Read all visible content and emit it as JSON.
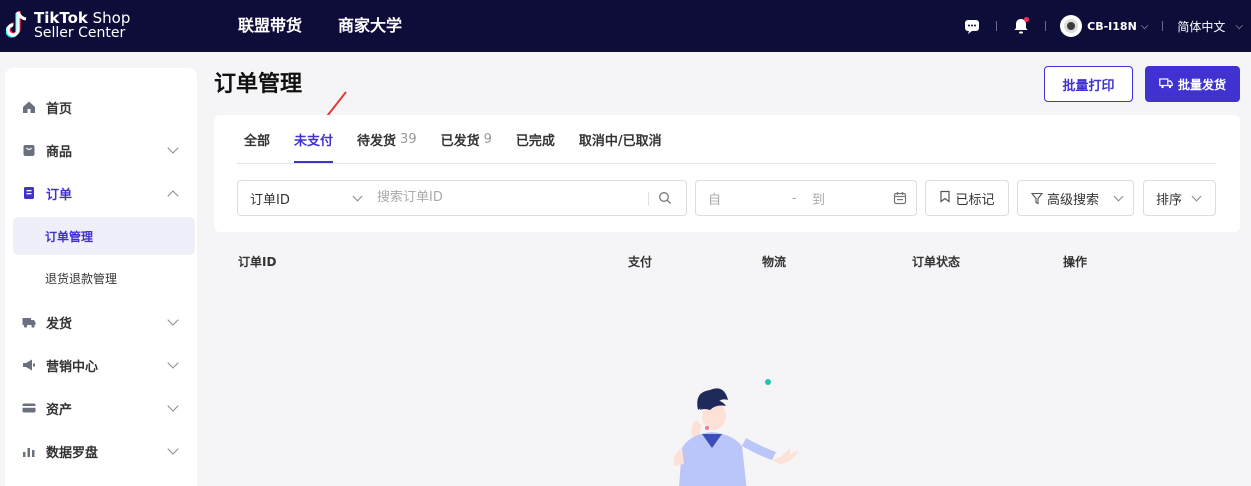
{
  "topbar": {
    "logo_line1_bold": "TikTok",
    "logo_line1_rest": " Shop",
    "logo_line2": "Seller Center",
    "nav": [
      "联盟带货",
      "商家大学"
    ],
    "user_name": "CB-I18N",
    "language": "简体中文"
  },
  "sidebar": {
    "items": [
      {
        "label": "首页",
        "icon": "home-icon"
      },
      {
        "label": "商品",
        "icon": "bag-icon"
      },
      {
        "label": "订单",
        "icon": "order-icon"
      },
      {
        "label": "发货",
        "icon": "truck-icon"
      },
      {
        "label": "营销中心",
        "icon": "megaphone-icon"
      },
      {
        "label": "资产",
        "icon": "card-icon"
      },
      {
        "label": "数据罗盘",
        "icon": "chart-icon"
      }
    ],
    "order_sub": [
      "订单管理",
      "退货退款管理"
    ]
  },
  "main": {
    "title": "订单管理",
    "btn_print": "批量打印",
    "btn_ship": "批量发货",
    "tabs": [
      {
        "label": "全部",
        "count": ""
      },
      {
        "label": "未支付",
        "count": ""
      },
      {
        "label": "待发货",
        "count": "39"
      },
      {
        "label": "已发货",
        "count": "9"
      },
      {
        "label": "已完成",
        "count": ""
      },
      {
        "label": "取消中/已取消",
        "count": ""
      }
    ],
    "active_tab": 1,
    "filters": {
      "select_value": "订单ID",
      "search_placeholder": "搜索订单ID",
      "date_from": "自",
      "date_sep": "-",
      "date_to": "到",
      "marked": "已标记",
      "advanced": "高级搜索",
      "sort": "排序"
    },
    "table_headers": [
      "订单ID",
      "支付",
      "物流",
      "订单状态",
      "操作"
    ]
  },
  "colors": {
    "topbar": "#0e0d3a",
    "accent": "#3f32d1",
    "notification": "#fe2c55"
  }
}
